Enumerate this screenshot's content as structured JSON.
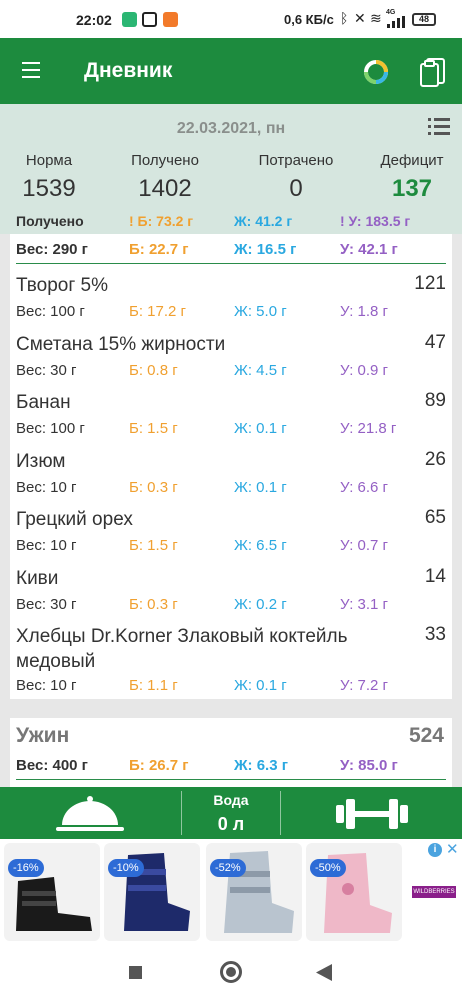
{
  "status_bar": {
    "time": "22:02",
    "speed": "0,6 КБ/с",
    "network": "4G",
    "battery": "48"
  },
  "app_bar": {
    "title": "Дневник"
  },
  "summary": {
    "date": "22.03.2021, пн",
    "norm_label": "Норма",
    "norm_value": "1539",
    "received_label": "Получено",
    "received_value": "1402",
    "spent_label": "Потрачено",
    "spent_value": "0",
    "deficit_label": "Дефицит",
    "deficit_value": "137",
    "totals_label": "Получено",
    "totals_b": "! Б: 73.2 г",
    "totals_zh": "Ж: 41.2 г",
    "totals_u": "! У: 183.5 г"
  },
  "meal_partial": {
    "weight": "Вес: 290 г",
    "b": "Б: 22.7 г",
    "zh": "Ж: 16.5 г",
    "u": "У: 42.1 г"
  },
  "foods": [
    {
      "name": "Творог 5%",
      "cal": "121",
      "w": "Вес: 100 г",
      "b": "Б: 17.2 г",
      "zh": "Ж: 5.0 г",
      "u": "У: 1.8 г"
    },
    {
      "name": "Сметана 15% жирности",
      "cal": "47",
      "w": "Вес: 30 г",
      "b": "Б: 0.8 г",
      "zh": "Ж: 4.5 г",
      "u": "У: 0.9 г"
    },
    {
      "name": "Банан",
      "cal": "89",
      "w": "Вес: 100 г",
      "b": "Б: 1.5 г",
      "zh": "Ж: 0.1 г",
      "u": "У: 21.8 г"
    },
    {
      "name": "Изюм",
      "cal": "26",
      "w": "Вес: 10 г",
      "b": "Б: 0.3 г",
      "zh": "Ж: 0.1 г",
      "u": "У: 6.6 г"
    },
    {
      "name": "Грецкий орех",
      "cal": "65",
      "w": "Вес: 10 г",
      "b": "Б: 1.5 г",
      "zh": "Ж: 6.5 г",
      "u": "У: 0.7 г"
    },
    {
      "name": "Киви",
      "cal": "14",
      "w": "Вес: 30 г",
      "b": "Б: 0.3 г",
      "zh": "Ж: 0.2 г",
      "u": "У: 3.1 г"
    },
    {
      "name": "Хлебцы Dr.Korner Злаковый коктейль медовый",
      "cal": "33",
      "w": "Вес: 10 г",
      "b": "Б: 1.1 г",
      "zh": "Ж: 0.1 г",
      "u": "У: 7.2 г"
    }
  ],
  "dinner": {
    "title": "Ужин",
    "cal": "524",
    "weight": "Вес: 400 г",
    "b": "Б: 26.7 г",
    "zh": "Ж: 6.3 г",
    "u": "У: 85.0 г"
  },
  "action_bar": {
    "water_label": "Вода",
    "water_value": "0 л"
  },
  "ad": {
    "discounts": [
      "-16%",
      "-10%",
      "-52%",
      "-50%"
    ],
    "brand": "WILDBERRIES"
  },
  "colors": {
    "brand_green": "#1d8b3e",
    "protein": "#f0a030",
    "fat": "#2aa8e0",
    "carbs": "#9460c4"
  }
}
